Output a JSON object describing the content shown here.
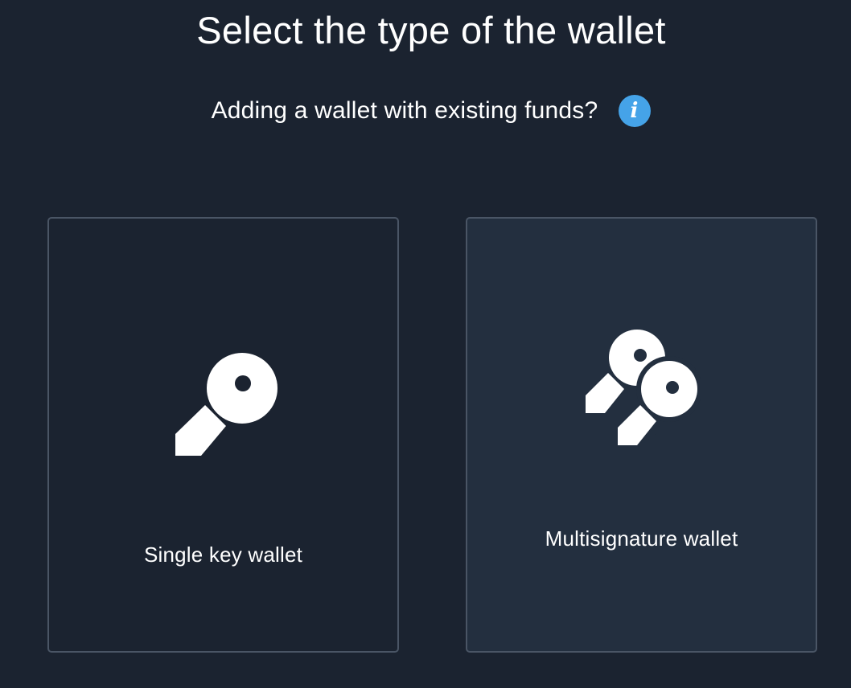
{
  "page": {
    "title": "Select the type of the wallet",
    "subtitle": "Adding a wallet with existing funds?"
  },
  "info_button": {
    "glyph": "i",
    "icon": "info-icon",
    "color": "#45a3e8"
  },
  "wallet_types": [
    {
      "label": "Single key wallet",
      "icon": "key-icon",
      "state": "default"
    },
    {
      "label": "Multisignature wallet",
      "icon": "keys-icon",
      "state": "hovered"
    }
  ],
  "colors": {
    "background": "#1b2330",
    "card_hover_background": "#232f3f",
    "card_border": "#4a5565",
    "text": "#ffffff"
  }
}
